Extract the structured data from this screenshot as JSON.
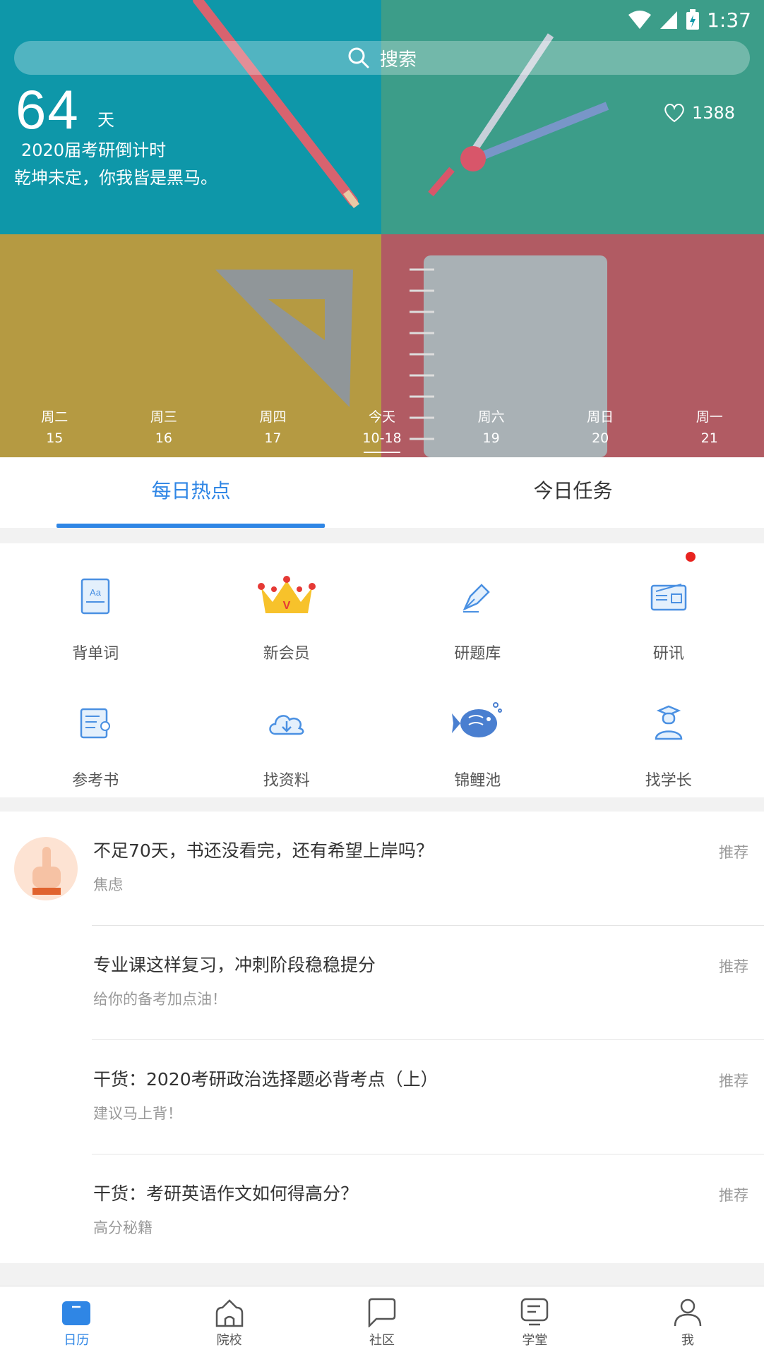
{
  "status": {
    "time": "1:37"
  },
  "search": {
    "label": "搜索"
  },
  "countdown": {
    "days": "64",
    "unit": "天",
    "caption": "2020届考研倒计时",
    "motto": "乾坤未定，你我皆是黑马。"
  },
  "likes": {
    "count": "1388"
  },
  "week": [
    {
      "weekday": "周二",
      "date": "15"
    },
    {
      "weekday": "周三",
      "date": "16"
    },
    {
      "weekday": "周四",
      "date": "17"
    },
    {
      "weekday": "今天",
      "date": "10-18"
    },
    {
      "weekday": "周六",
      "date": "19"
    },
    {
      "weekday": "周日",
      "date": "20"
    },
    {
      "weekday": "周一",
      "date": "21"
    }
  ],
  "tabs": [
    {
      "label": "每日热点"
    },
    {
      "label": "今日任务"
    }
  ],
  "grid": [
    {
      "label": "背单词",
      "icon": "vocabulary-book-icon"
    },
    {
      "label": "新会员",
      "icon": "crown-icon"
    },
    {
      "label": "研题库",
      "icon": "pen-nib-icon"
    },
    {
      "label": "研讯",
      "icon": "news-card-icon"
    },
    {
      "label": "参考书",
      "icon": "reference-book-icon"
    },
    {
      "label": "找资料",
      "icon": "cloud-download-icon"
    },
    {
      "label": "锦鲤池",
      "icon": "koi-fish-icon"
    },
    {
      "label": "找学长",
      "icon": "graduate-icon"
    }
  ],
  "articles": [
    {
      "title": "不足70天，书还没看完，还有希望上岸吗？",
      "sub": "焦虑",
      "tag": "推荐"
    },
    {
      "title": "专业课这样复习，冲刺阶段稳稳提分",
      "sub": "给你的备考加点油！",
      "tag": "推荐"
    },
    {
      "title": "干货：2020考研政治选择题必背考点（上）",
      "sub": "建议马上背！",
      "tag": "推荐"
    },
    {
      "title": "干货：考研英语作文如何得高分？",
      "sub": "高分秘籍",
      "tag": "推荐"
    }
  ],
  "nav": [
    {
      "label": "日历",
      "icon": "calendar-icon"
    },
    {
      "label": "院校",
      "icon": "school-icon"
    },
    {
      "label": "社区",
      "icon": "chat-bubble-icon"
    },
    {
      "label": "学堂",
      "icon": "classroom-icon"
    },
    {
      "label": "我",
      "icon": "user-icon"
    }
  ],
  "colors": {
    "accent": "#2f86e5",
    "notification": "#e8231f"
  }
}
